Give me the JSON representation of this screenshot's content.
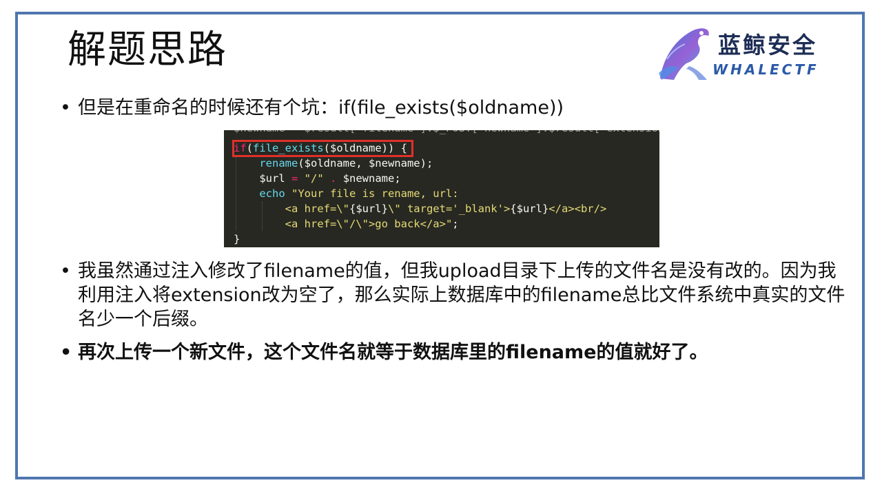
{
  "slide": {
    "title": "解题思路",
    "logo": {
      "name_cn": "蓝鲸安全",
      "name_en": "WHALECTF"
    },
    "bullets": [
      {
        "marker": "•",
        "text": "但是在重命名的时候还有个坑：if(file_exists($oldname))"
      },
      {
        "marker": "•",
        "text": "我虽然通过注入修改了filename的值，但我upload目录下上传的文件名是没有改的。因为我利用注入将extension改为空了，那么实际上数据库中的filename总比文件系统中真实的文件名少一个后缀。"
      },
      {
        "marker": "•",
        "text": "再次上传一个新文件，这个文件名就等于数据库里的filename的值就好了。"
      }
    ],
    "code": {
      "cut_line": "$newname = $result['filename'].$_POST['newname'].$result['extension'];",
      "lines": [
        "if(file_exists($oldname)) {",
        "    rename($oldname, $newname);",
        "    $url = \"/\" . $newname;",
        "    echo \"Your file is rename, url:",
        "        <a href=\\\"{$url}\\\" target='_blank'>{$url}</a><br/>",
        "        <a href=\\\"/\\\">go back</a>\";",
        "}"
      ]
    }
  },
  "colors": {
    "frame": "#4f76b0",
    "code_bg": "#272822",
    "highlight": "#e0302a"
  }
}
